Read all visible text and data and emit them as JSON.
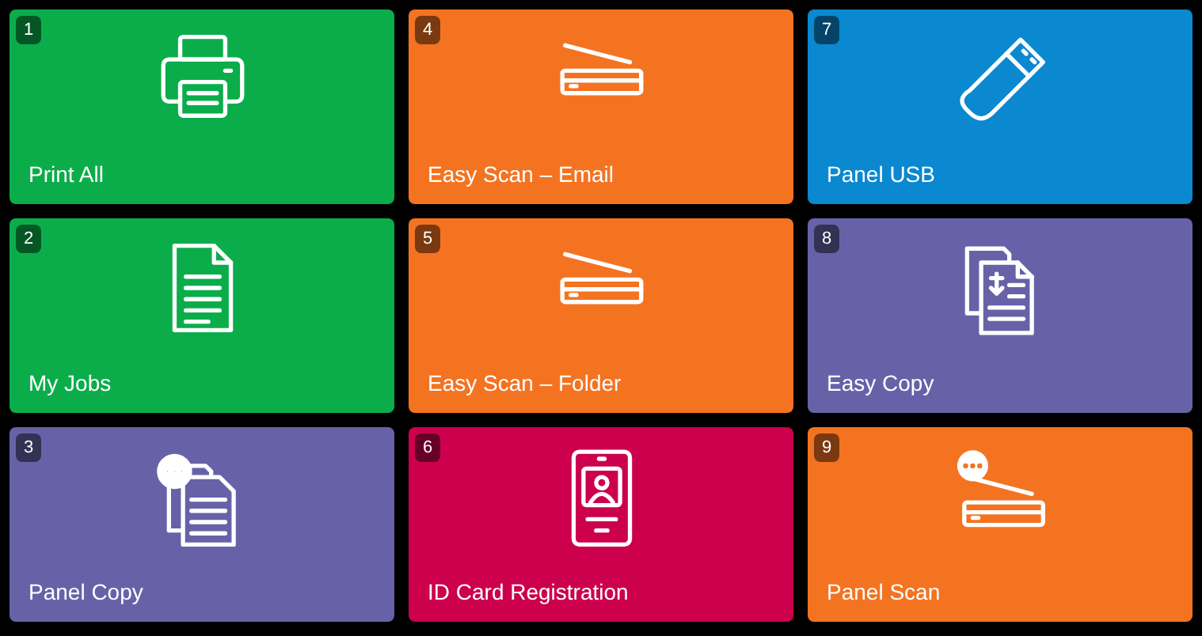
{
  "tiles": [
    {
      "number": "1",
      "label": "Print All",
      "kind": "printer",
      "color": "#0bad4b"
    },
    {
      "number": "4",
      "label": "Easy Scan – Email",
      "kind": "scanner",
      "color": "#f47321"
    },
    {
      "number": "7",
      "label": "Panel USB",
      "kind": "usb",
      "color": "#0a88d0"
    },
    {
      "number": "2",
      "label": "My Jobs",
      "kind": "document",
      "color": "#0bad4b"
    },
    {
      "number": "5",
      "label": "Easy Scan – Folder",
      "kind": "scanner",
      "color": "#f47321"
    },
    {
      "number": "8",
      "label": "Easy Copy",
      "kind": "copy",
      "color": "#6762a8"
    },
    {
      "number": "3",
      "label": "Panel Copy",
      "kind": "panel-copy",
      "color": "#6762a8"
    },
    {
      "number": "6",
      "label": "ID Card Registration",
      "kind": "id-card",
      "color": "#cc004c"
    },
    {
      "number": "9",
      "label": "Panel Scan",
      "kind": "panel-scan",
      "color": "#f47321"
    }
  ]
}
